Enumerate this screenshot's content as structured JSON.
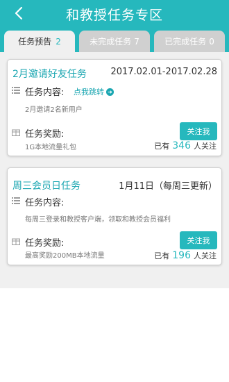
{
  "header": {
    "title": "和教授任务专区"
  },
  "tabs": [
    {
      "label": "任务预告",
      "count": "2"
    },
    {
      "label": "未完成任务",
      "count": "7"
    },
    {
      "label": "已完成任务",
      "count": "0"
    }
  ],
  "tasks": [
    {
      "title": "2月邀请好友任务",
      "date": "2017.02.01-2017.02.28",
      "content_label": "任务内容:",
      "jump_label": "点我跳转",
      "content_desc": "2月邀请2名新用户",
      "reward_label": "任务奖励:",
      "reward_desc": "1G本地流量礼包",
      "follow_label": "关注我",
      "followers_prefix": "已有",
      "followers_count": "346",
      "followers_suffix": "人关注"
    },
    {
      "title": "周三会员日任务",
      "date": "1月11日（每周三更新）",
      "content_label": "任务内容:",
      "content_desc": "每周三登录和教授客户端，领取和教授会员福利",
      "reward_label": "任务奖励:",
      "reward_desc": "最高奖励200MB本地流量",
      "follow_label": "关注我",
      "followers_prefix": "已有",
      "followers_count": "196",
      "followers_suffix": "人关注"
    }
  ],
  "colors": {
    "accent": "#26b8bd",
    "title_text": "#1aa6b1",
    "background": "#f0f0f0",
    "inactive_tab": "#d0d0d0"
  },
  "icons": {
    "back": "chevron-left-icon",
    "list": "list-icon",
    "gift": "gift-icon",
    "arrow": "arrow-right-circle-icon"
  }
}
